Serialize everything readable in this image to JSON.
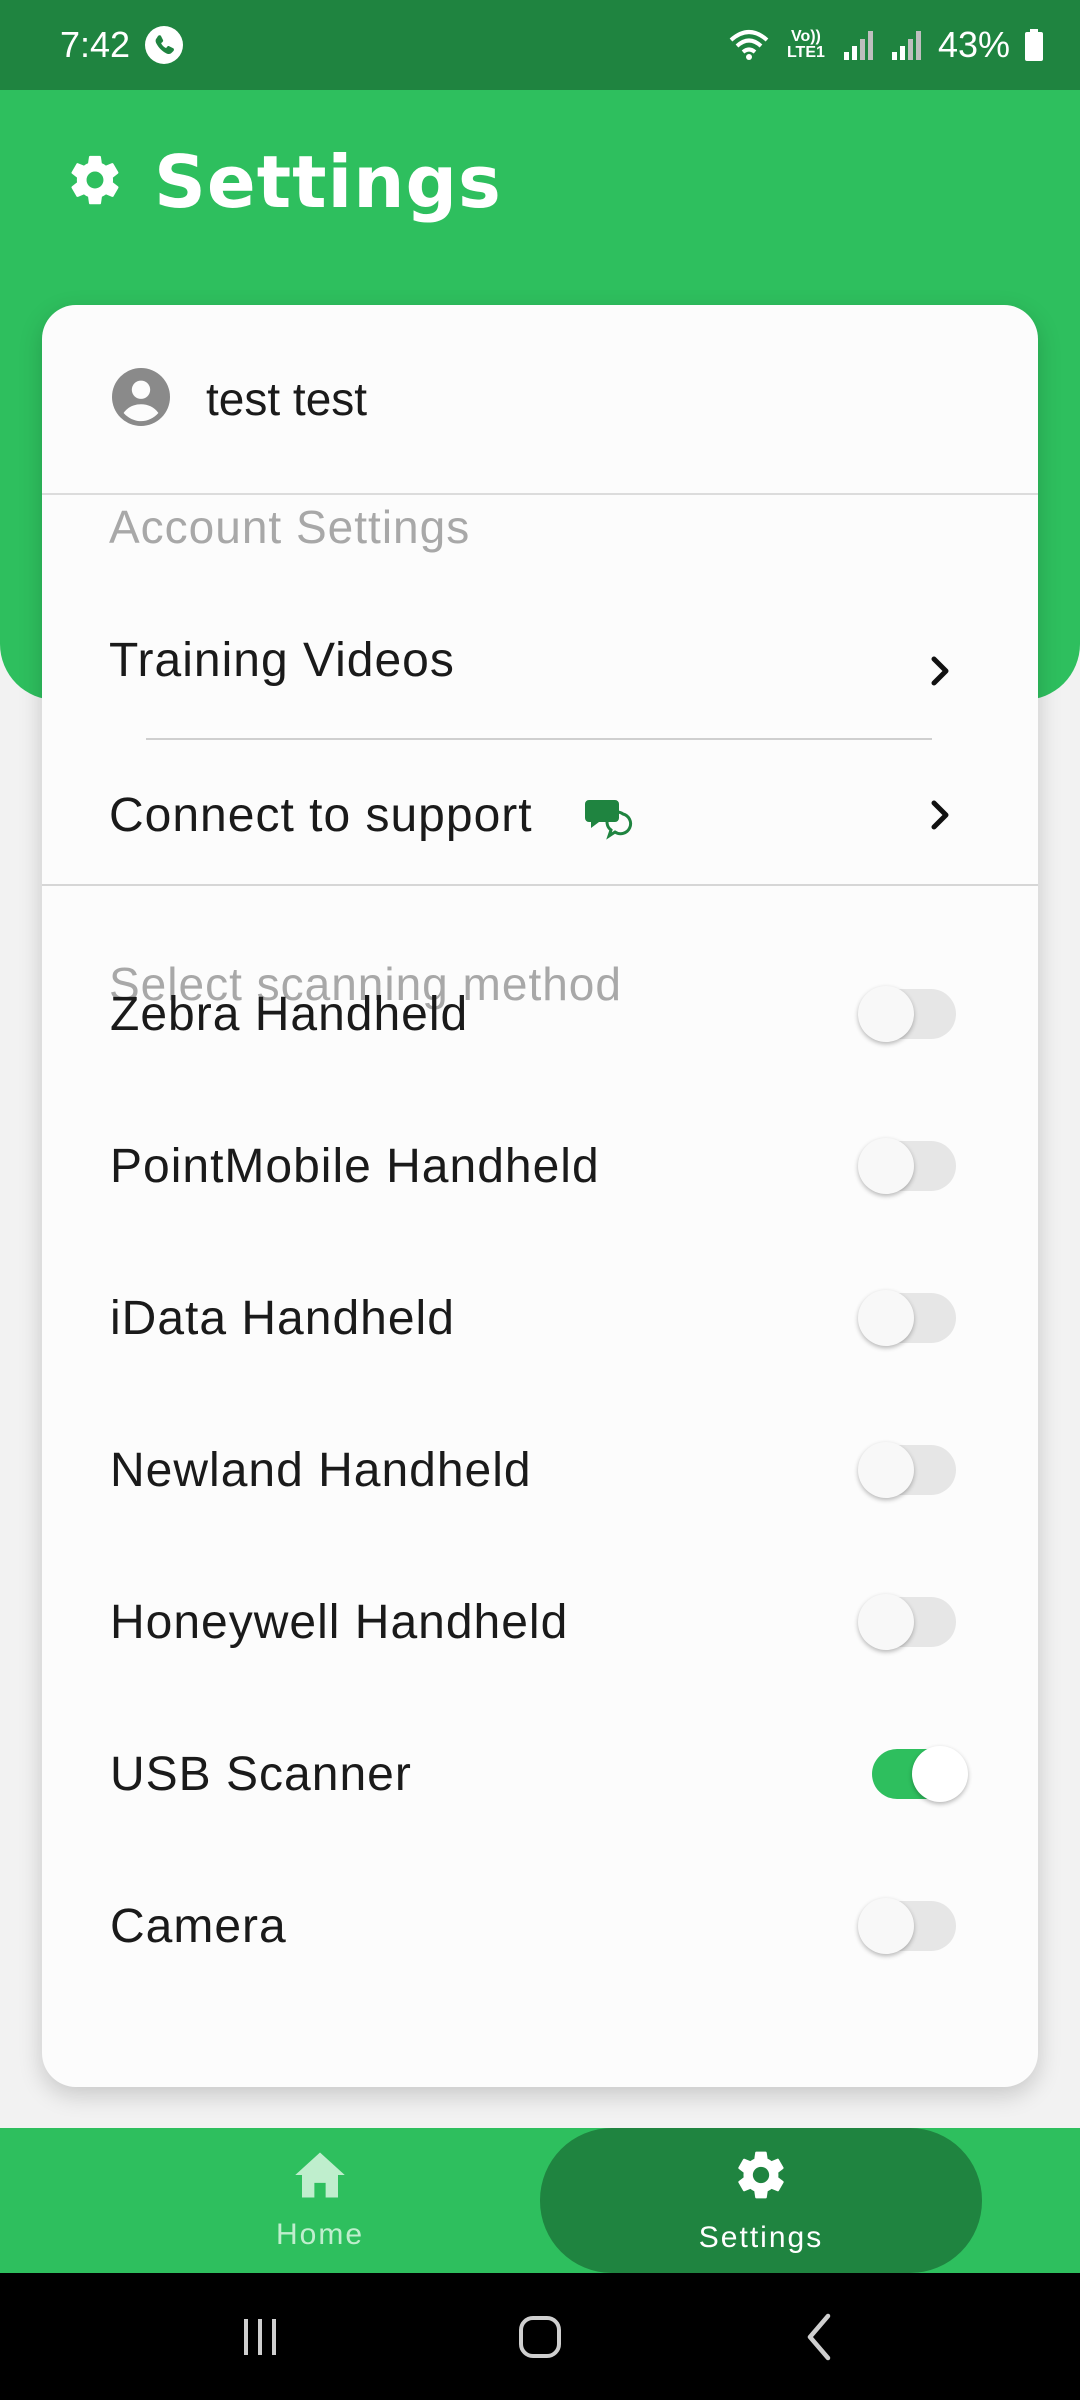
{
  "status_bar": {
    "time": "7:42",
    "network": "Vo)) LTE1",
    "battery": "43%"
  },
  "header": {
    "title": "Settings",
    "icon": "gear-icon"
  },
  "user": {
    "name": "test test",
    "icon": "account-circle-icon"
  },
  "account_section": {
    "label": "Account Settings",
    "items": [
      {
        "label": "Training Videos",
        "icon": "chevron-right-icon"
      },
      {
        "label": "Connect to support",
        "icon": "chat-bubbles-icon"
      }
    ]
  },
  "scanning_section": {
    "label": "Select scanning method",
    "options": [
      {
        "label": "Zebra Handheld",
        "enabled": false
      },
      {
        "label": "PointMobile Handheld",
        "enabled": false
      },
      {
        "label": "iData Handheld",
        "enabled": false
      },
      {
        "label": "Newland Handheld",
        "enabled": false
      },
      {
        "label": "Honeywell Handheld",
        "enabled": false
      },
      {
        "label": "USB Scanner",
        "enabled": true
      },
      {
        "label": "Camera",
        "enabled": false
      }
    ]
  },
  "bottom_nav": {
    "items": [
      {
        "label": "Home",
        "icon": "home-icon",
        "active": false
      },
      {
        "label": "Settings",
        "icon": "gear-icon",
        "active": true
      }
    ]
  },
  "colors": {
    "primary_green": "#2ebf5e",
    "dark_green": "#1f8440",
    "support_icon_green": "#1f8440"
  }
}
